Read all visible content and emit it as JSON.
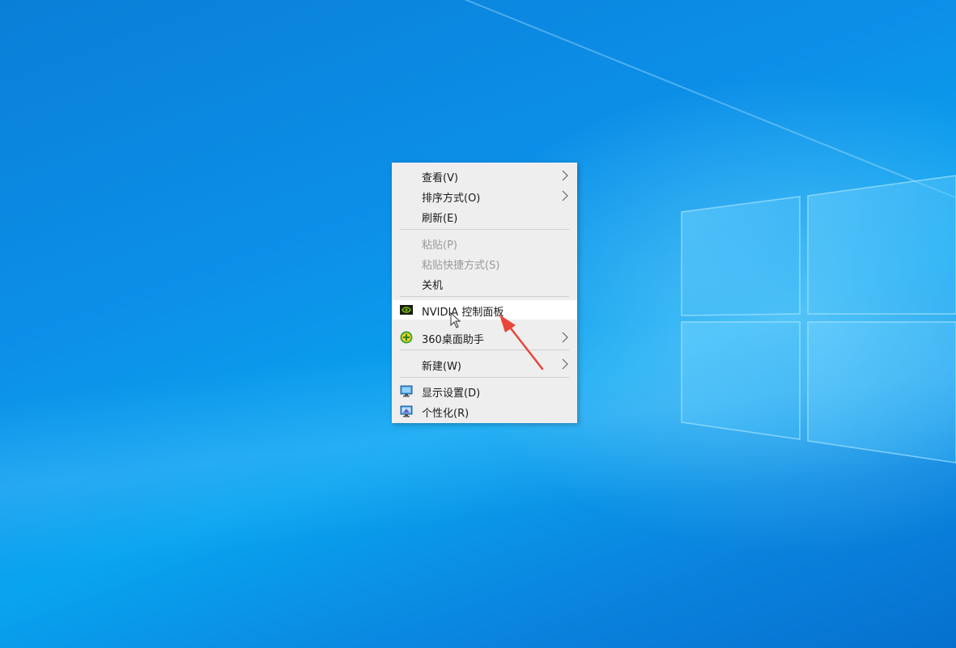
{
  "desktop": {
    "accent": "#0a8ee6"
  },
  "context_menu": {
    "items": [
      {
        "label": "查看(V)",
        "has_submenu": true,
        "enabled": true
      },
      {
        "label": "排序方式(O)",
        "has_submenu": true,
        "enabled": true
      },
      {
        "label": "刷新(E)",
        "has_submenu": false,
        "enabled": true
      },
      {
        "label": "粘贴(P)",
        "has_submenu": false,
        "enabled": false
      },
      {
        "label": "粘贴快捷方式(S)",
        "has_submenu": false,
        "enabled": false
      },
      {
        "label": "关机",
        "has_submenu": false,
        "enabled": true
      },
      {
        "label": "NVIDIA 控制面板",
        "has_submenu": false,
        "enabled": true,
        "icon": "nvidia-icon",
        "highlighted": true
      },
      {
        "label": "360桌面助手",
        "has_submenu": true,
        "enabled": true,
        "icon": "360-icon"
      },
      {
        "label": "新建(W)",
        "has_submenu": true,
        "enabled": true
      },
      {
        "label": "显示设置(D)",
        "has_submenu": false,
        "enabled": true,
        "icon": "display-icon"
      },
      {
        "label": "个性化(R)",
        "has_submenu": false,
        "enabled": true,
        "icon": "personalize-icon"
      }
    ]
  },
  "annotation": {
    "arrow_color": "#e8463a"
  }
}
